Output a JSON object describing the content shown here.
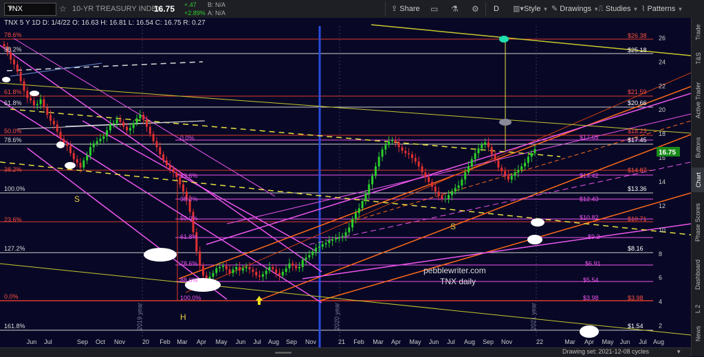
{
  "toolbar": {
    "symbol": "TNX",
    "description": "10-YR TREASURY INDEX",
    "last": "16.75",
    "change": "+.47",
    "change_pct": "+2.89%",
    "bid": "B: N/A",
    "ask": "A: N/A",
    "share": "Share",
    "period": "D",
    "style": "Style",
    "drawings": "Drawings",
    "studies": "Studies",
    "patterns": "Patterns"
  },
  "chart_header": "TNX 5 Y 1D  D: 1/4/22  O: 16.63  H: 16.81  L: 16.54  C: 16.75  R: 0.27",
  "chart_data": {
    "type": "candlestick",
    "ylim": [
      1,
      27
    ],
    "yticks": [
      "26",
      "24",
      "22",
      "20",
      "18",
      "16",
      "14",
      "12",
      "10",
      "8",
      "6",
      "4",
      "2"
    ],
    "x_labels": [
      "Jun",
      "Jul",
      "Sep",
      "Oct",
      "Nov",
      "20",
      "Feb",
      "Mar",
      "Apr",
      "May",
      "Jun",
      "Jul",
      "Aug",
      "Sep",
      "Nov",
      "21",
      "Feb",
      "Mar",
      "Apr",
      "May",
      "Jun",
      "Jul",
      "Aug",
      "Sep",
      "Nov",
      "22",
      "Mar",
      "Apr",
      "May",
      "Jun",
      "Jul",
      "Aug"
    ],
    "year_markers": [
      "2019 year",
      "2020 year",
      "2021 year"
    ],
    "last_price": "16.75",
    "fib_left": [
      "78.6%",
      "38.2%",
      "61.8%",
      "61.8%",
      "50.0%",
      "78.6%",
      "38.2%",
      "100.0%",
      "23.6%",
      "127.2%",
      "0.0%",
      "161.8%"
    ],
    "fib_mid": [
      "0.0%",
      "23.6%",
      "38.2%",
      "50.0%",
      "61.8%",
      "78.6%",
      "88.6%",
      "100.0%"
    ],
    "level_labels_pink": [
      "$17.65",
      "$14.42",
      "$12.43",
      "$10.82",
      "$9.2",
      "$6.91",
      "$5.54",
      "$3.98"
    ],
    "level_labels_red": [
      "$26.38",
      "$21.59",
      "$18.23",
      "$14.87",
      "$10.71",
      "$3.98"
    ],
    "level_labels_white": [
      "$25.18",
      "$20.66",
      "$17.45",
      "$13.36",
      "$8.16",
      "$1.54"
    ],
    "pattern_labels": [
      "S",
      "S",
      "H"
    ],
    "watermark": [
      "pebblewriter.com",
      "TNX daily"
    ],
    "closes": [
      25.3,
      24.8,
      24.2,
      23.8,
      23.2,
      22.4,
      21.6,
      21.0,
      20.8,
      20.4,
      20.5,
      20.9,
      20.2,
      19.6,
      19.1,
      18.8,
      18.2,
      17.6,
      17.2,
      17.0,
      16.4,
      15.9,
      15.6,
      15.2,
      15.8,
      16.2,
      16.9,
      17.2,
      17.4,
      17.6,
      17.8,
      18.3,
      18.8,
      18.9,
      19.2,
      19.0,
      18.6,
      18.3,
      18.5,
      18.9,
      19.3,
      19.6,
      19.2,
      18.6,
      18.0,
      17.4,
      16.9,
      16.3,
      15.8,
      15.4,
      15.1,
      14.8,
      14.4,
      13.8,
      13.2,
      12.5,
      11.5,
      9.8,
      8.2,
      7.0,
      6.2,
      5.9,
      6.1,
      6.4,
      6.8,
      6.9,
      7.0,
      6.7,
      6.4,
      6.7,
      6.9,
      6.6,
      6.8,
      6.9,
      6.7,
      6.5,
      6.2,
      6.1,
      6.3,
      6.6,
      6.9,
      6.7,
      6.4,
      6.2,
      6.5,
      6.8,
      7.2,
      7.0,
      6.8,
      6.9,
      7.5,
      7.7,
      7.9,
      8.2,
      8.5,
      8.6,
      8.8,
      8.9,
      9.1,
      9.2,
      9.3,
      9.4,
      9.5,
      9.8,
      10.2,
      10.9,
      11.4,
      11.8,
      12.4,
      13.0,
      13.8,
      14.5,
      15.3,
      16.1,
      16.7,
      17.1,
      17.4,
      17.5,
      17.3,
      16.9,
      16.6,
      16.4,
      16.3,
      16.0,
      15.7,
      15.3,
      14.8,
      14.4,
      14.0,
      13.6,
      13.2,
      12.9,
      12.6,
      12.6,
      12.9,
      13.2,
      13.5,
      13.7,
      14.2,
      14.8,
      15.3,
      15.9,
      16.4,
      16.8,
      17.1,
      17.3,
      16.9,
      16.3,
      15.8,
      15.2,
      14.9,
      14.6,
      14.2,
      14.5,
      14.8,
      15.0,
      15.3,
      15.6,
      16.1,
      16.4,
      16.75
    ]
  },
  "right_tabs": [
    "Trade",
    "T&S",
    "Active Trader",
    "Buttons",
    "Chart",
    "Phase Scores",
    "Dashboard",
    "L 2",
    "News"
  ],
  "status": "Drawing set: 2021-12-08 cycles"
}
